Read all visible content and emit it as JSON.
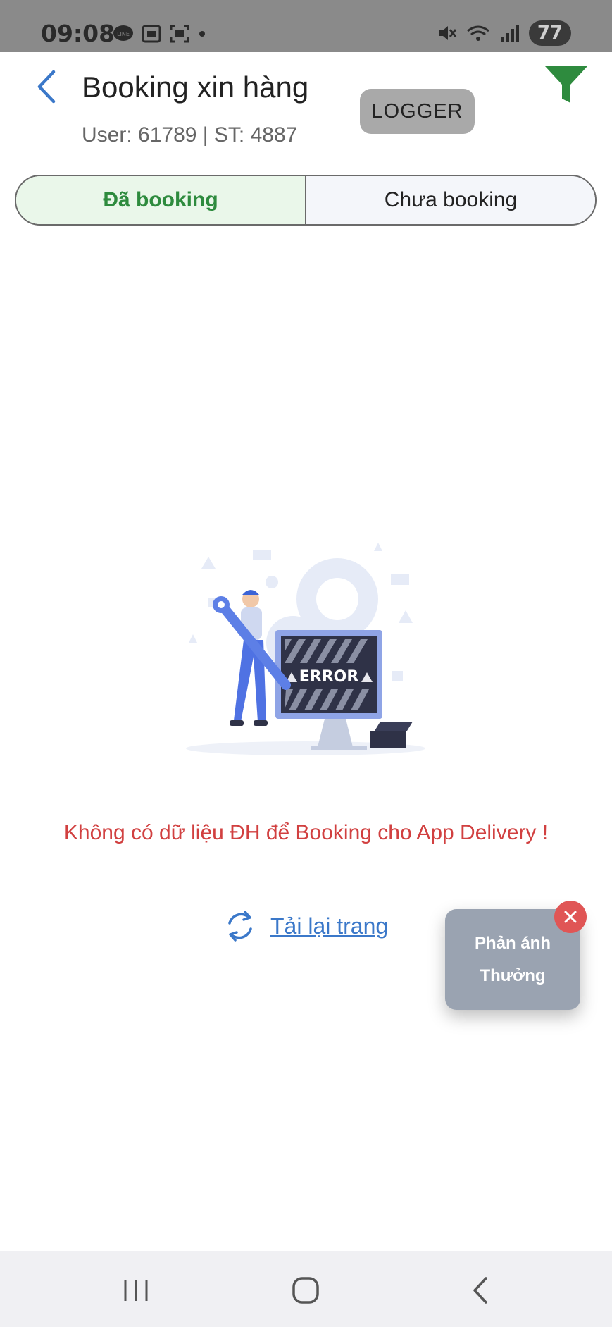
{
  "status_bar": {
    "time": "09:08",
    "left_icons": [
      "line-app-icon",
      "screenshot-icon",
      "scan-icon",
      "dot-icon"
    ],
    "right_icons": [
      "mute-icon",
      "wifi-icon",
      "signal-icon"
    ],
    "battery": "77"
  },
  "header": {
    "title": "Booking xin hàng",
    "subtitle": "User: 61789 | ST: 4887",
    "logger_label": "LOGGER",
    "accent_color": "#2e8b3e"
  },
  "tabs": [
    {
      "label": "Đã booking",
      "active": true
    },
    {
      "label": "Chưa booking",
      "active": false
    }
  ],
  "illustration": {
    "error_text": "ERROR"
  },
  "empty_state": {
    "message": "Không có dữ liệu ĐH để Booking cho App Delivery !",
    "reload_label": "Tải lại trang"
  },
  "feedback": {
    "line1": "Phản ánh",
    "line2": "Thưởng"
  },
  "nav_bar": {
    "buttons": [
      "recents-icon",
      "home-icon",
      "back-icon"
    ]
  }
}
